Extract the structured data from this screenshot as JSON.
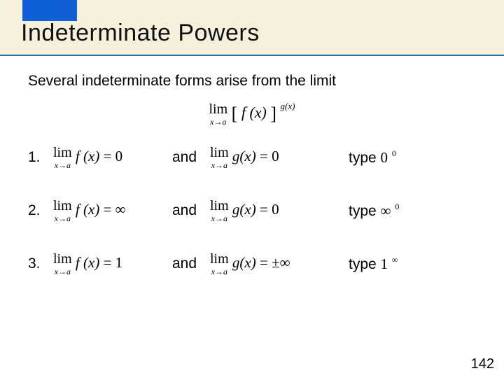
{
  "title": "Indeterminate Powers",
  "intro": "Several indeterminate forms arise from the limit",
  "main": {
    "lim": "lim",
    "under": "x→a",
    "lbr": "[",
    "fx": "f (x)",
    "rbr": "]",
    "gx": "g(x)"
  },
  "rows": [
    {
      "num": "1.",
      "f_lim": "lim",
      "f_under": "x→a",
      "f_expr": "f (x)",
      "f_eq": " = 0",
      "and": "and",
      "g_lim": "lim",
      "g_under": "x→a",
      "g_expr": "g(x)",
      "g_eq": " = 0",
      "type_word": "type ",
      "type_base": "0",
      "type_exp": "0"
    },
    {
      "num": "2.",
      "f_lim": "lim",
      "f_under": "x→a",
      "f_expr": "f (x)",
      "f_eq": " = ∞",
      "and": "and",
      "g_lim": "lim",
      "g_under": "x→a",
      "g_expr": "g(x)",
      "g_eq": " = 0",
      "type_word": "type ",
      "type_base": "∞",
      "type_exp": " 0"
    },
    {
      "num": "3.",
      "f_lim": "lim",
      "f_under": "x→a",
      "f_expr": "f (x)",
      "f_eq": " = 1",
      "and": "and",
      "g_lim": "lim",
      "g_under": "x→a",
      "g_expr": "g(x)",
      "g_eq": " = ±∞",
      "type_word": "type ",
      "type_base": "1",
      "type_exp": "∞"
    }
  ],
  "pagenum": "142"
}
